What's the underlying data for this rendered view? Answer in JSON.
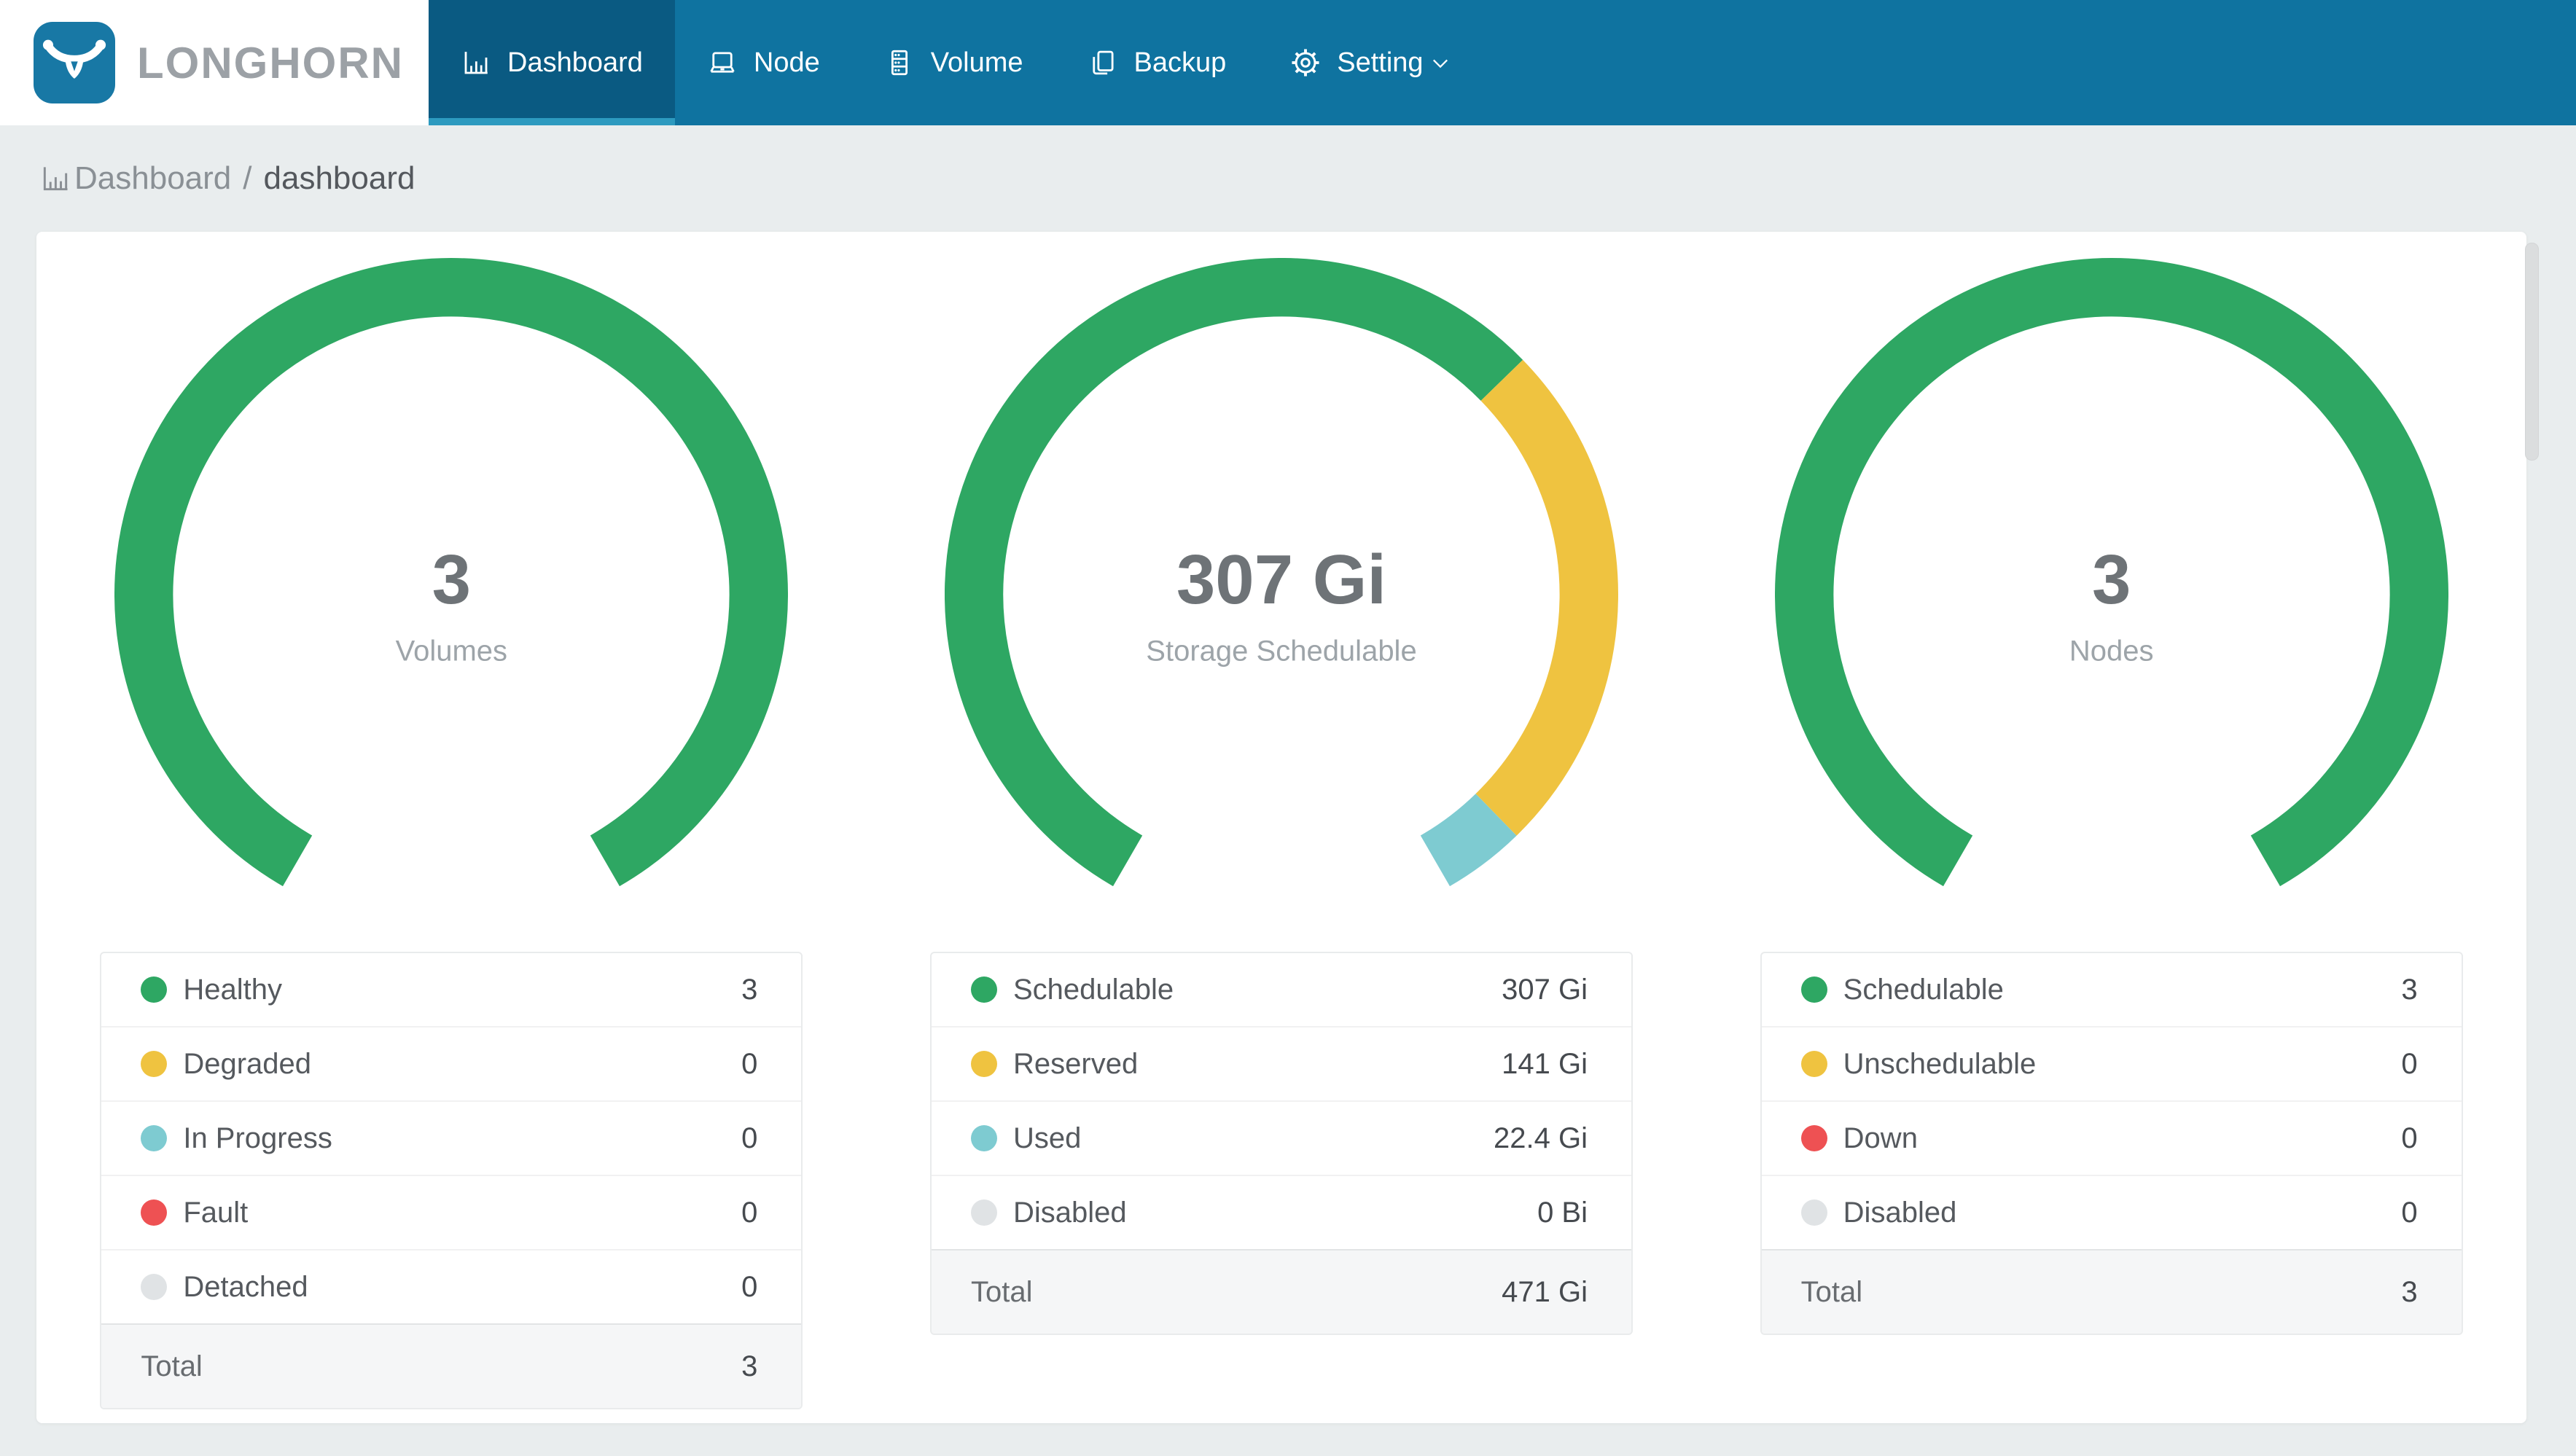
{
  "colors": {
    "nav_bg": "#0F73A0",
    "nav_active_bg": "#0A5A82",
    "nav_active_underline": "#2D9ABF",
    "logo_bg": "#1878A5",
    "brand_text": "#9CA1A6",
    "page_bg": "#E9EDEE",
    "status_green": "#2EA763",
    "status_yellow": "#EFC340",
    "status_teal": "#7ECBD1",
    "status_red": "#EE5153",
    "status_gray": "#E0E3E5"
  },
  "brand": {
    "name": "LONGHORN"
  },
  "nav": {
    "items": [
      {
        "label": "Dashboard",
        "icon": "bar-chart-icon",
        "active": true
      },
      {
        "label": "Node",
        "icon": "laptop-icon",
        "active": false
      },
      {
        "label": "Volume",
        "icon": "server-icon",
        "active": false
      },
      {
        "label": "Backup",
        "icon": "copy-icon",
        "active": false
      },
      {
        "label": "Setting",
        "icon": "gear-icon",
        "active": false,
        "has_dropdown": true
      }
    ]
  },
  "breadcrumb": {
    "root": "Dashboard",
    "separator": "/",
    "current": "dashboard"
  },
  "charts": [
    {
      "center_value": "3",
      "center_label": "Volumes",
      "legend": [
        {
          "label": "Healthy",
          "value": "3",
          "color": "#2EA763"
        },
        {
          "label": "Degraded",
          "value": "0",
          "color": "#EFC340"
        },
        {
          "label": "In Progress",
          "value": "0",
          "color": "#7ECBD1"
        },
        {
          "label": "Fault",
          "value": "0",
          "color": "#EE5153"
        },
        {
          "label": "Detached",
          "value": "0",
          "color": "#E0E3E5"
        }
      ],
      "total": {
        "label": "Total",
        "value": "3"
      },
      "chart_data": {
        "type": "donut",
        "title": "Volumes",
        "center_text": "3",
        "arc_span_deg": 300,
        "start_angle_deg": 210,
        "segments": [
          {
            "label": "Healthy",
            "value": 3,
            "color": "#2EA763"
          },
          {
            "label": "Degraded",
            "value": 0,
            "color": "#EFC340"
          },
          {
            "label": "In Progress",
            "value": 0,
            "color": "#7ECBD1"
          },
          {
            "label": "Fault",
            "value": 0,
            "color": "#EE5153"
          },
          {
            "label": "Detached",
            "value": 0,
            "color": "#E0E3E5"
          }
        ],
        "total_value": 3
      }
    },
    {
      "center_value": "307 Gi",
      "center_label": "Storage Schedulable",
      "legend": [
        {
          "label": "Schedulable",
          "value": "307 Gi",
          "color": "#2EA763"
        },
        {
          "label": "Reserved",
          "value": "141 Gi",
          "color": "#EFC340"
        },
        {
          "label": "Used",
          "value": "22.4 Gi",
          "color": "#7ECBD1"
        },
        {
          "label": "Disabled",
          "value": "0 Bi",
          "color": "#E0E3E5"
        }
      ],
      "total": {
        "label": "Total",
        "value": "471 Gi"
      },
      "chart_data": {
        "type": "donut",
        "title": "Storage Schedulable",
        "center_text": "307 Gi",
        "arc_span_deg": 300,
        "start_angle_deg": 210,
        "segments": [
          {
            "label": "Schedulable",
            "value": 307,
            "color": "#2EA763"
          },
          {
            "label": "Reserved",
            "value": 141,
            "color": "#EFC340"
          },
          {
            "label": "Used",
            "value": 22.4,
            "color": "#7ECBD1"
          },
          {
            "label": "Disabled",
            "value": 0,
            "color": "#E0E3E5"
          }
        ],
        "total_value": 471,
        "unit": "Gi"
      }
    },
    {
      "center_value": "3",
      "center_label": "Nodes",
      "legend": [
        {
          "label": "Schedulable",
          "value": "3",
          "color": "#2EA763"
        },
        {
          "label": "Unschedulable",
          "value": "0",
          "color": "#EFC340"
        },
        {
          "label": "Down",
          "value": "0",
          "color": "#EE5153"
        },
        {
          "label": "Disabled",
          "value": "0",
          "color": "#E0E3E5"
        }
      ],
      "total": {
        "label": "Total",
        "value": "3"
      },
      "chart_data": {
        "type": "donut",
        "title": "Nodes",
        "center_text": "3",
        "arc_span_deg": 300,
        "start_angle_deg": 210,
        "segments": [
          {
            "label": "Schedulable",
            "value": 3,
            "color": "#2EA763"
          },
          {
            "label": "Unschedulable",
            "value": 0,
            "color": "#EFC340"
          },
          {
            "label": "Down",
            "value": 0,
            "color": "#EE5153"
          },
          {
            "label": "Disabled",
            "value": 0,
            "color": "#E0E3E5"
          }
        ],
        "total_value": 3
      }
    }
  ]
}
